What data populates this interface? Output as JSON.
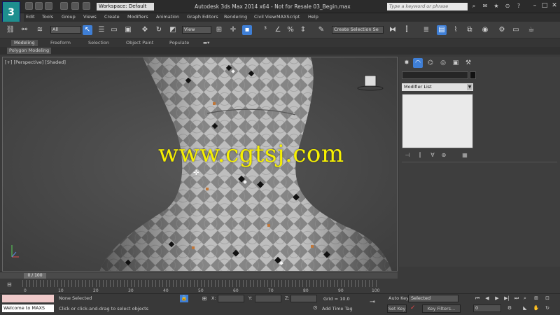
{
  "titlebar": {
    "workspace": "Workspace: Default",
    "window_title": "Autodesk 3ds Max 2014 x64 - Not for Resale  03_Begin.max",
    "search_placeholder": "Type a keyword or phrase"
  },
  "menus": [
    "Edit",
    "Tools",
    "Group",
    "Views",
    "Create",
    "Modifiers",
    "Animation",
    "Graph Editors",
    "Rendering",
    "Civil View",
    "MAXScript",
    "Help"
  ],
  "toolbar": {
    "filter": "All",
    "refcoord": "View",
    "selection_set": "Create Selection Se"
  },
  "ribbon": {
    "tabs": [
      "Modeling",
      "Freeform",
      "Selection",
      "Object Paint",
      "Populate"
    ],
    "subtab": "Polygon Modeling"
  },
  "viewport": {
    "label": "[+] [Perspective] [Shaded]",
    "watermark": "www.cgtsj.com"
  },
  "command_panel": {
    "modifier_list": "Modifier List"
  },
  "timeline": {
    "frame_display": "0 / 100",
    "ticks": [
      "0",
      "10",
      "20",
      "30",
      "40",
      "50",
      "60",
      "70",
      "80",
      "90",
      "100"
    ]
  },
  "status": {
    "welcome": "Welcome to MAXS",
    "none_selected": "None Selected",
    "prompt": "Click or click-and-drag to select objects",
    "x_label": "X:",
    "y_label": "Y:",
    "z_label": "Z:",
    "grid": "Grid = 10.0",
    "add_time_tag": "Add Time Tag",
    "auto_key": "Auto Key",
    "selected": "Selected",
    "set_key": "Set Key",
    "key_filters": "Key Filters...",
    "current_frame": "0"
  }
}
